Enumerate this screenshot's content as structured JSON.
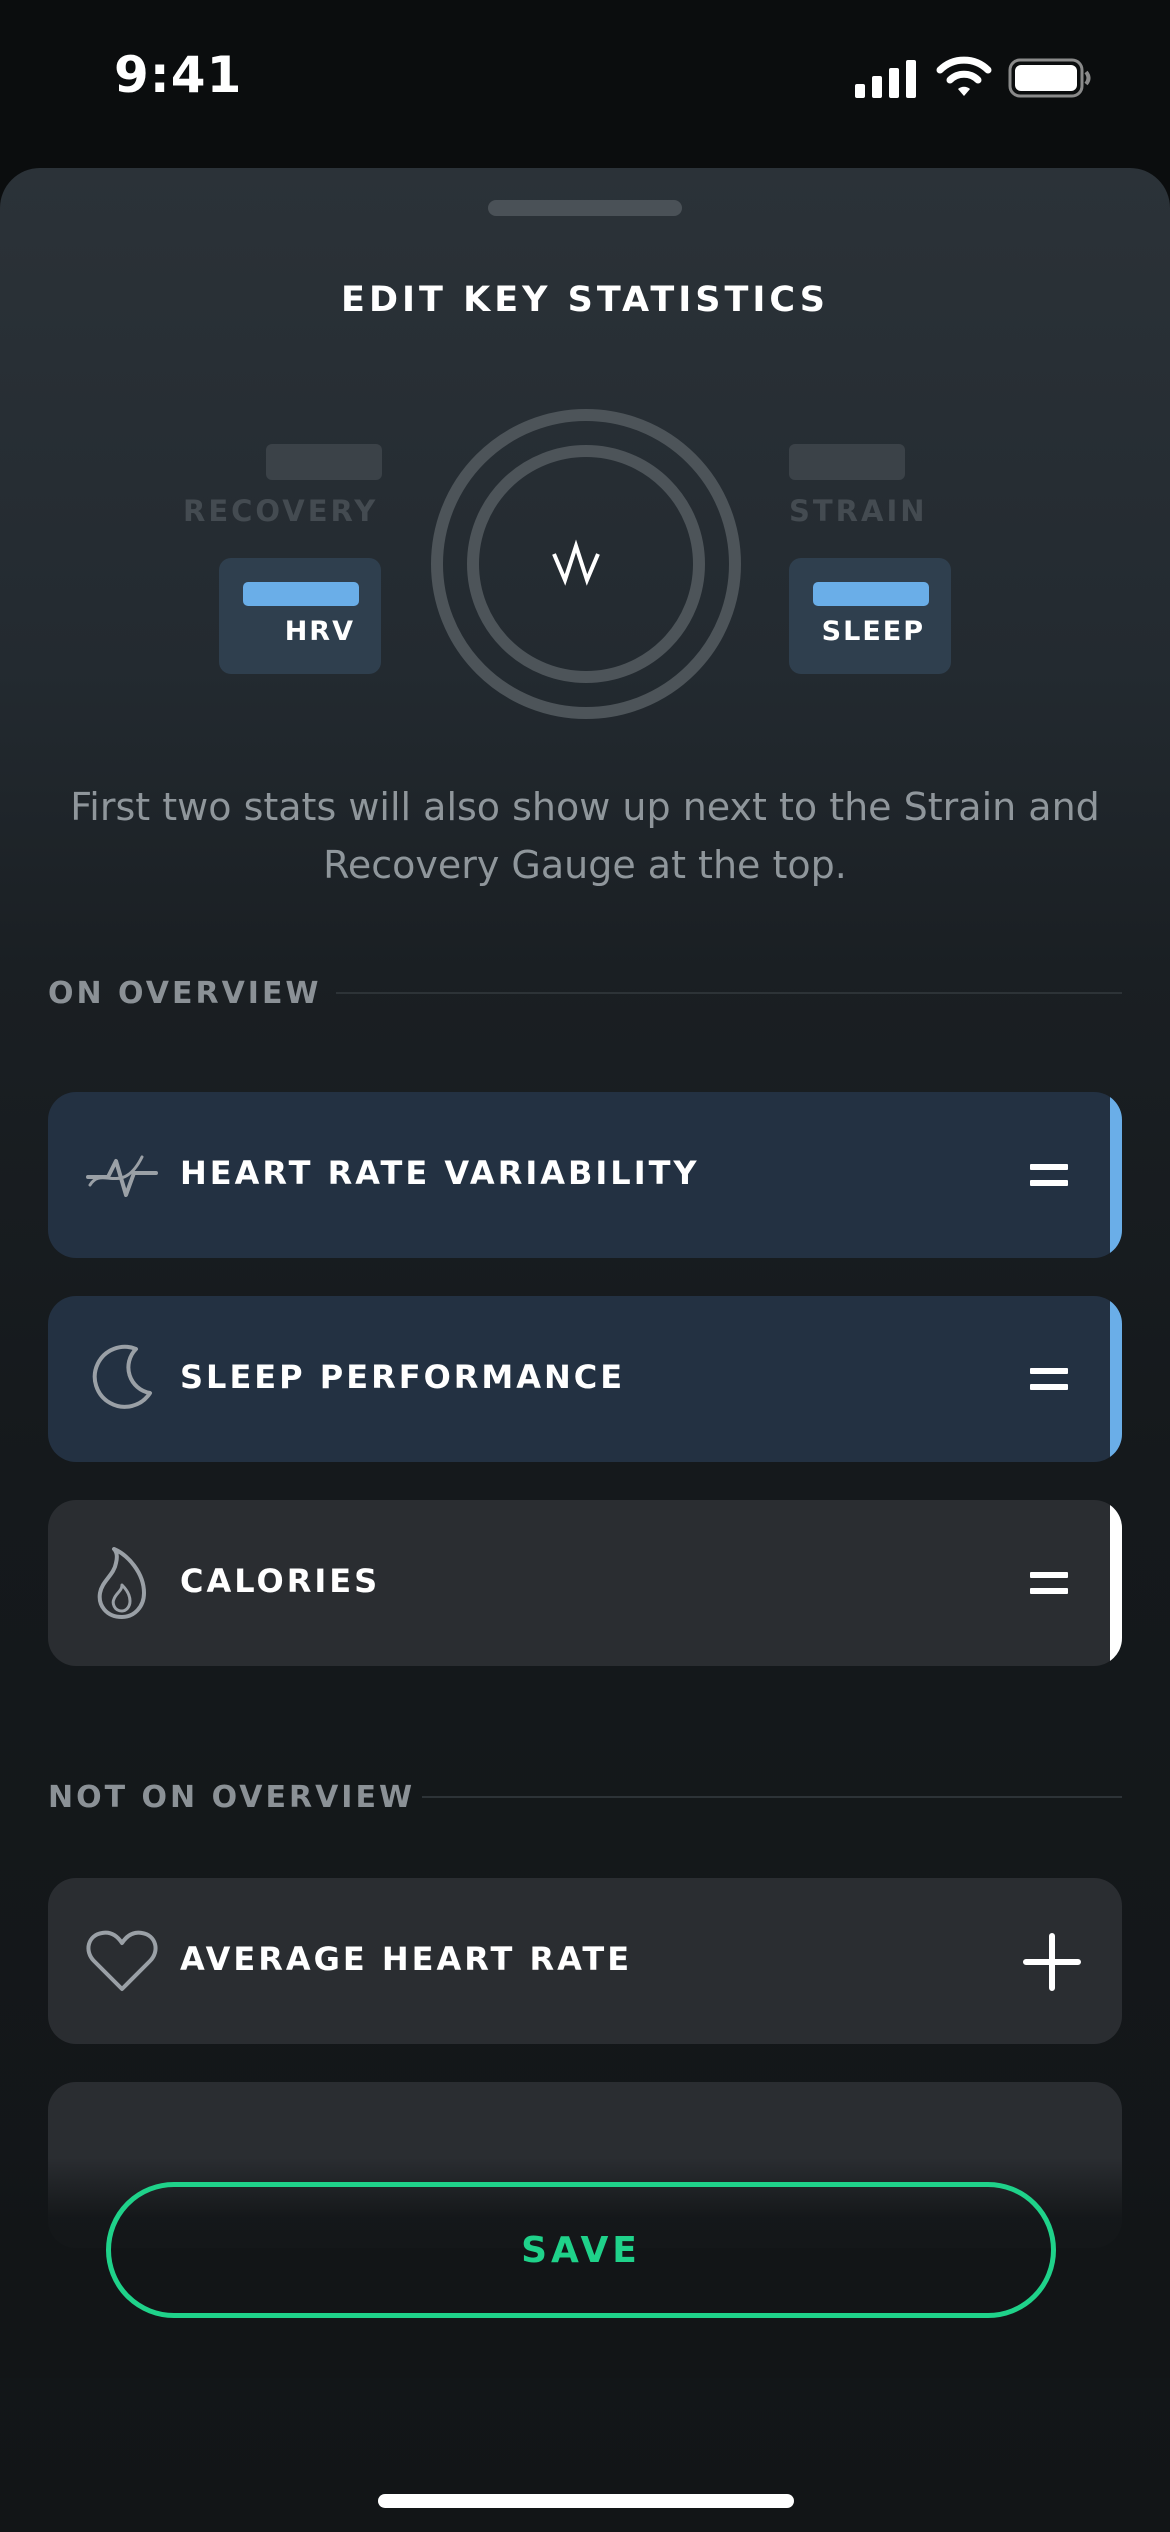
{
  "status_bar": {
    "time": "9:41"
  },
  "sheet": {
    "title": "EDIT KEY STATISTICS",
    "preview": {
      "left_label": "RECOVERY",
      "right_label": "STRAIN",
      "left_chip": "HRV",
      "right_chip": "SLEEP",
      "logo_text": "W"
    },
    "description": "First two stats will also show up next to the Strain and Recovery Gauge at the top.",
    "on_overview": {
      "heading": "ON OVERVIEW",
      "items": [
        {
          "label": "HEART RATE VARIABILITY",
          "icon": "hrv-icon"
        },
        {
          "label": "SLEEP PERFORMANCE",
          "icon": "moon-icon"
        },
        {
          "label": "CALORIES",
          "icon": "flame-icon"
        }
      ]
    },
    "not_on_overview": {
      "heading": "NOT ON OVERVIEW",
      "items": [
        {
          "label": "AVERAGE HEART RATE",
          "icon": "heart-icon"
        }
      ]
    },
    "save_label": "SAVE"
  },
  "colors": {
    "accent_green": "#1fd28a",
    "accent_blue": "#6aaee8"
  }
}
